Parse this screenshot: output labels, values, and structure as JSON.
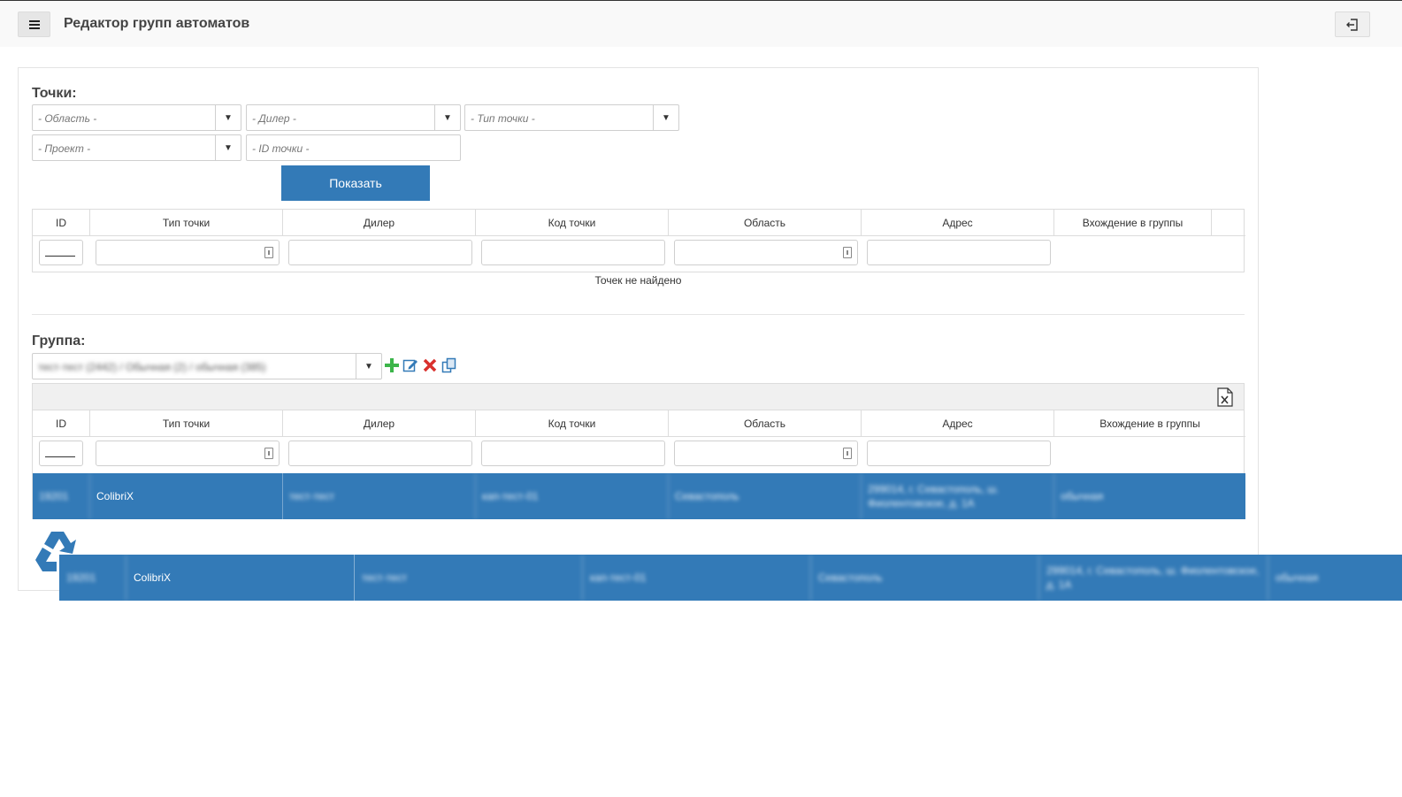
{
  "header": {
    "title": "Редактор групп автоматов",
    "menu_icon": "hamburger-icon",
    "logout_icon": "logout-icon"
  },
  "points": {
    "title": "Точки:",
    "filters": {
      "region": "- Область -",
      "dealer": "- Дилер -",
      "point_type": "- Тип точки -",
      "project": "- Проект -",
      "point_id": "- ID точки -"
    },
    "show_button": "Показать",
    "columns": [
      "ID",
      "Тип точки",
      "Дилер",
      "Код точки",
      "Область",
      "Адрес",
      "Вхождение в группы"
    ],
    "empty_text": "Точек не найдено"
  },
  "group": {
    "title": "Группа:",
    "selected": "тест-тест (2442) / Обычная (2) / обычная (385)",
    "columns": [
      "ID",
      "Тип точки",
      "Дилер",
      "Код точки",
      "Область",
      "Адрес",
      "Вхождение в группы"
    ],
    "rows": [
      {
        "id": "19201",
        "type": "ColibriX",
        "dealer": "тест-тест",
        "code": "кап-тест-01",
        "region": "Севастополь",
        "address": "299014, г. Севастополь, ш. Фиолентовское, д. 1А",
        "groups": "обычная"
      }
    ]
  },
  "drag_row": {
    "id": "19201",
    "type": "ColibriX",
    "dealer": "тест-тест",
    "code": "кап-тест-01",
    "region": "Севастополь",
    "address": "299014, г. Севастополь, ш. Фиолентовское, д. 1А",
    "groups": "обычная"
  },
  "colors": {
    "accent": "#337ab7",
    "add": "#3cb54a",
    "delete": "#d9302c"
  }
}
